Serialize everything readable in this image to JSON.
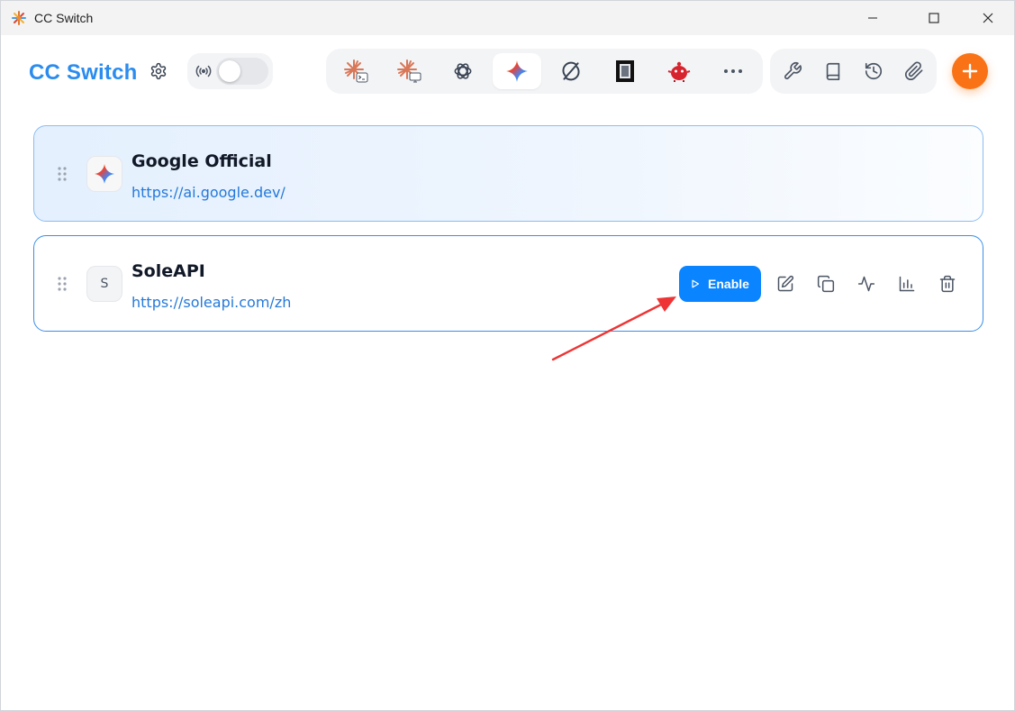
{
  "window": {
    "title": "CC Switch",
    "icons": [
      "app-logo-icon",
      "minimize-icon",
      "maximize-icon",
      "close-icon"
    ]
  },
  "header": {
    "brand": "CC Switch",
    "settings_icon": "gear-icon",
    "proxy": {
      "icon": "broadcast-icon",
      "enabled": false
    },
    "app_tabs": [
      {
        "name": "claude-code-icon",
        "active": false
      },
      {
        "name": "claude-desktop-icon",
        "active": false
      },
      {
        "name": "openai-codex-icon",
        "active": false
      },
      {
        "name": "gemini-icon",
        "active": true
      },
      {
        "name": "opencode-icon",
        "active": false
      },
      {
        "name": "terminal-app-icon",
        "active": false
      },
      {
        "name": "mascot-app-icon",
        "active": false
      },
      {
        "name": "more-icon",
        "active": false
      }
    ],
    "tools": [
      "wrench-icon",
      "book-icon",
      "history-icon",
      "paperclip-icon"
    ],
    "add_icon": "plus-icon",
    "accent": "#f97316",
    "brand_color": "#2b8cee"
  },
  "providers": [
    {
      "name": "Google Official",
      "url": "https://ai.google.dev/",
      "icon": "gemini-icon",
      "active": true
    },
    {
      "name": "SoleAPI",
      "url": "https://soleapi.com/zh",
      "initial": "S",
      "active": false,
      "enable_label": "Enable"
    }
  ],
  "row_actions": [
    "edit-icon",
    "copy-icon",
    "activity-icon",
    "bar-chart-icon",
    "trash-icon"
  ]
}
